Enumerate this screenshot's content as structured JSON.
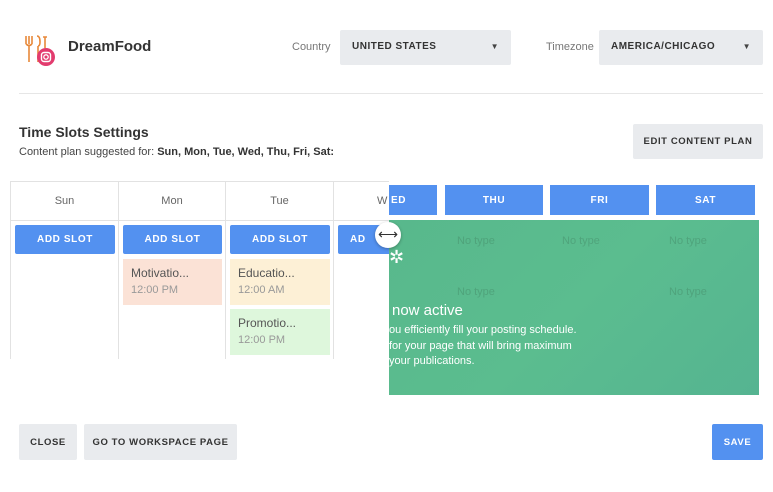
{
  "header": {
    "brand": "DreamFood",
    "country_label": "Country",
    "country_value": "UNITED STATES",
    "timezone_label": "Timezone",
    "timezone_value": "AMERICA/CHICAGO"
  },
  "settings": {
    "title": "Time Slots Settings",
    "plan_prefix": "Content plan suggested for:",
    "plan_days": "Sun, Mon, Tue, Wed, Thu, Fri, Sat:",
    "edit_button": "EDIT CONTENT PLAN"
  },
  "grid": {
    "add_slot": "ADD SLOT",
    "columns": [
      {
        "day": "Sun",
        "slots": []
      },
      {
        "day": "Mon",
        "slots": [
          {
            "title": "Motivatio...",
            "time": "12:00 PM"
          }
        ]
      },
      {
        "day": "Tue",
        "slots": [
          {
            "title": "Educatio...",
            "time": "12:00 AM"
          },
          {
            "title": "Promotio...",
            "time": "12:00 PM"
          }
        ]
      },
      {
        "day": "W",
        "slots": []
      }
    ],
    "add_slot_partial": "AD"
  },
  "overlay": {
    "headers": [
      "ED",
      "THU",
      "FRI",
      "SAT"
    ],
    "ghost_slot_label": "No type",
    "title": "now active",
    "lines": [
      "ou efficiently fill your posting schedule.",
      "for your page that will bring maximum",
      "your publications."
    ]
  },
  "footer": {
    "close": "CLOSE",
    "workspace": "GO TO WORKSPACE PAGE",
    "save": "SAVE"
  },
  "colors": {
    "primary": "#5391f0",
    "overlay_green": "#58b88c",
    "slot_peach": "#fbe2d6",
    "slot_yellow": "#fdf0d6",
    "slot_green": "#def7dc"
  },
  "icons": {
    "logo": "dreamfood-logo-icon",
    "caret": "chevron-down-icon",
    "handle": "resize-handle-icon",
    "sparkle": "sparkle-icon"
  }
}
